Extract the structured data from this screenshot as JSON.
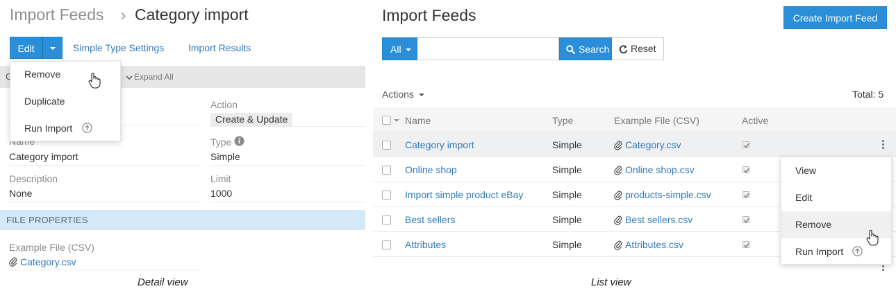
{
  "detail": {
    "breadcrumb": {
      "parent": "Import Feeds",
      "separator": "›",
      "current": "Category import"
    },
    "toolbar": {
      "edit_label": "Edit",
      "tabs": [
        "Simple Type Settings",
        "Import Results"
      ]
    },
    "panel": {
      "header_letter": "G",
      "expand_all": "Expand All"
    },
    "dropdown": {
      "items": [
        {
          "label": "Remove"
        },
        {
          "label": "Duplicate"
        },
        {
          "label": "Run Import"
        }
      ]
    },
    "fields": {
      "action_label": "Action",
      "action_value": "Create & Update",
      "name_label": "Name",
      "name_value": "Category import",
      "type_label": "Type",
      "type_value": "Simple",
      "description_label": "Description",
      "description_value": "None",
      "limit_label": "Limit",
      "limit_value": "1000"
    },
    "file_properties": {
      "header": "FILE PROPERTIES",
      "example_label": "Example File (CSV)",
      "example_value": "Category.csv"
    },
    "caption": "Detail view"
  },
  "list": {
    "title": "Import Feeds",
    "create_button": "Create Import Feed",
    "filter": {
      "all_label": "All",
      "search_label": "Search",
      "reset_label": "Reset",
      "search_value": ""
    },
    "actions_label": "Actions",
    "total_label": "Total: 5",
    "columns": [
      "Name",
      "Type",
      "Example File (CSV)",
      "Active"
    ],
    "rows": [
      {
        "name": "Category import",
        "type": "Simple",
        "file": "Category.csv",
        "active": true
      },
      {
        "name": "Online shop",
        "type": "Simple",
        "file": "Online shop.csv",
        "active": true
      },
      {
        "name": "Import simple product eBay",
        "type": "Simple",
        "file": "products-simple.csv",
        "active": true
      },
      {
        "name": "Best sellers",
        "type": "Simple",
        "file": "Best sellers.csv",
        "active": true
      },
      {
        "name": "Attributes",
        "type": "Simple",
        "file": "Attributes.csv",
        "active": true
      }
    ],
    "row_menu": {
      "items": [
        "View",
        "Edit",
        "Remove",
        "Run Import"
      ],
      "highlighted": "Remove"
    },
    "caption": "List view"
  },
  "colors": {
    "primary": "#2a8fd8",
    "link": "#337ab7",
    "section_header": "#d5e8f7"
  }
}
